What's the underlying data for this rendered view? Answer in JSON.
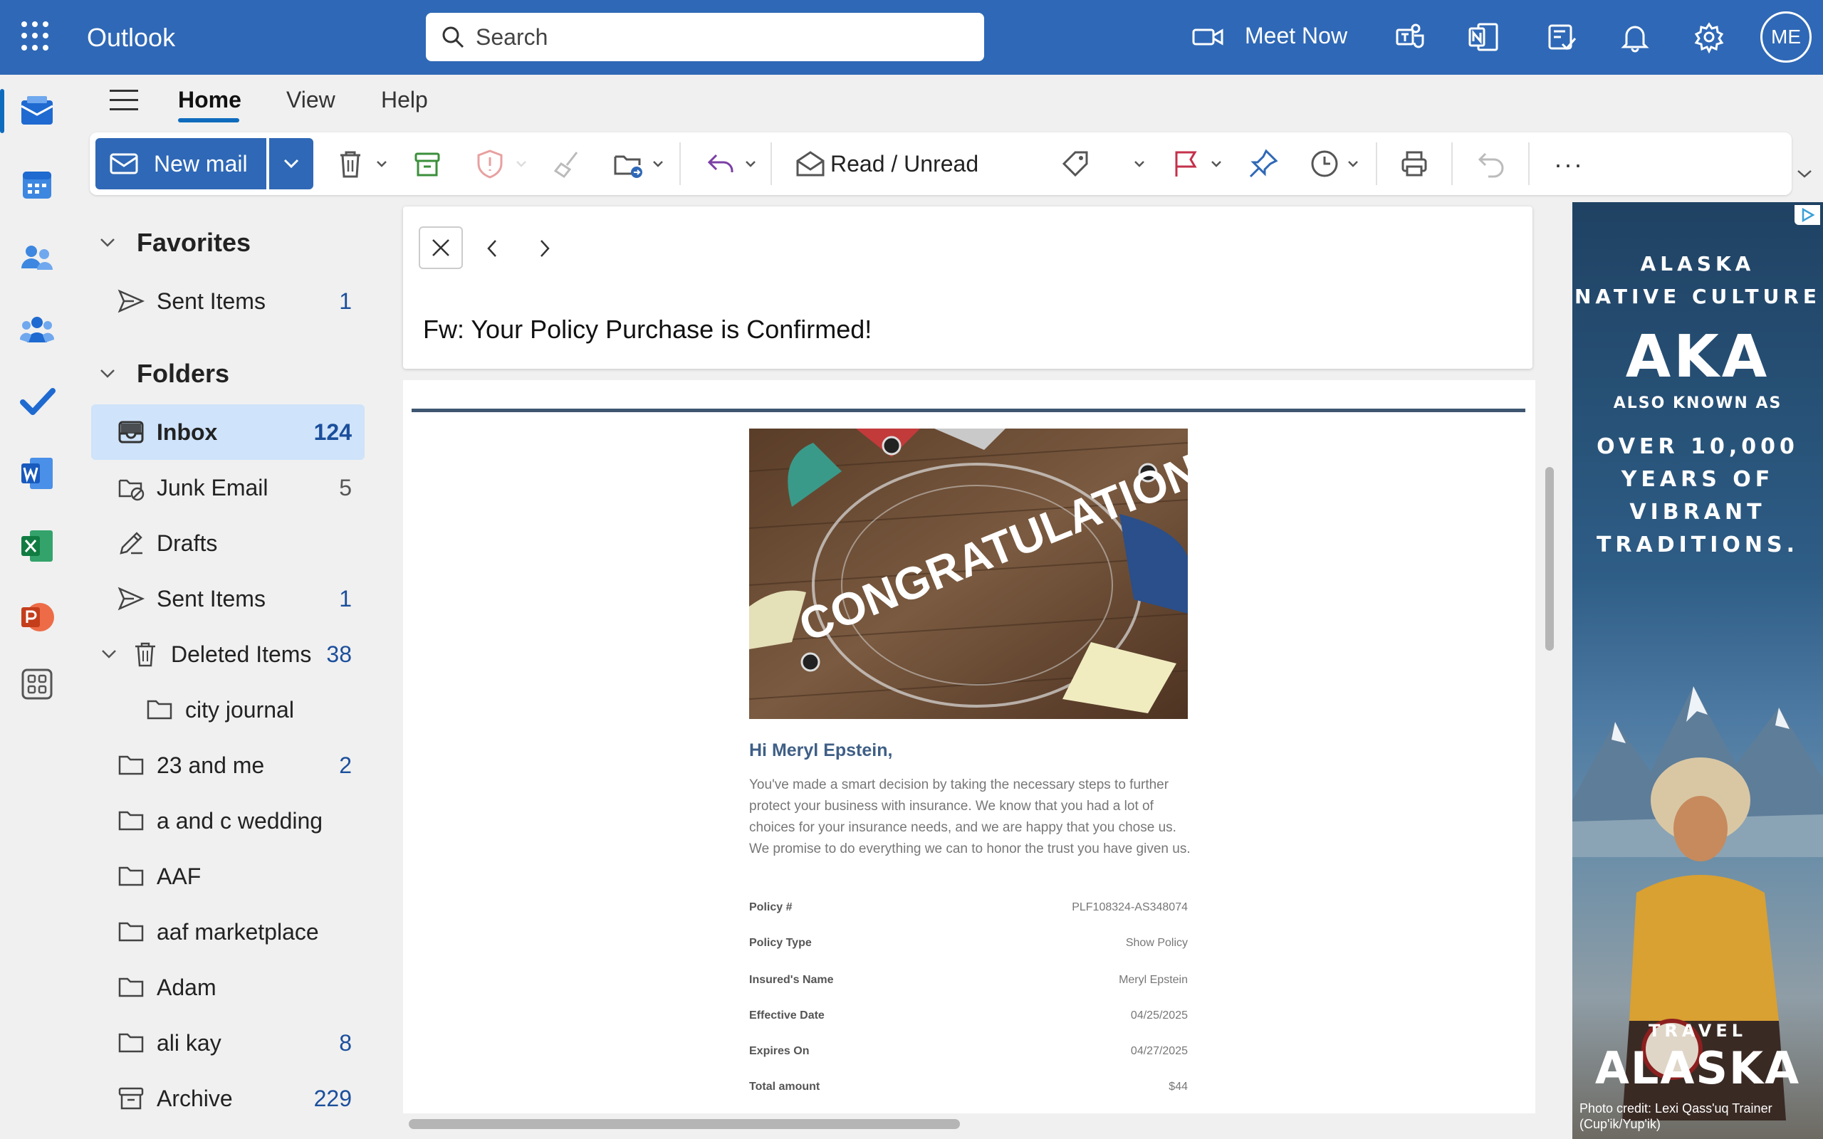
{
  "app": {
    "title": "Outlook",
    "user_initials": "ME"
  },
  "search": {
    "placeholder": "Search"
  },
  "topbar": {
    "meet_now_label": "Meet Now"
  },
  "ribbon_tabs": [
    "Home",
    "View",
    "Help"
  ],
  "toolbar": {
    "new_mail_label": "New mail",
    "read_unread_label": "Read / Unread",
    "more_label": "···"
  },
  "favorites": {
    "heading": "Favorites",
    "items": [
      {
        "label": "Sent Items",
        "count": "1"
      }
    ]
  },
  "folders": {
    "heading": "Folders",
    "items": [
      {
        "label": "Inbox",
        "count": "124"
      },
      {
        "label": "Junk Email",
        "count": "5"
      },
      {
        "label": "Drafts",
        "count": ""
      },
      {
        "label": "Sent Items",
        "count": "1"
      },
      {
        "label": "Deleted Items",
        "count": "38"
      },
      {
        "label": "city journal",
        "count": ""
      },
      {
        "label": "23 and me",
        "count": "2"
      },
      {
        "label": "a and c wedding",
        "count": ""
      },
      {
        "label": "AAF",
        "count": ""
      },
      {
        "label": "aaf marketplace",
        "count": ""
      },
      {
        "label": "Adam",
        "count": ""
      },
      {
        "label": "ali kay",
        "count": "8"
      },
      {
        "label": "Archive",
        "count": "229"
      }
    ]
  },
  "message": {
    "subject": "Fw: Your Policy Purchase is Confirmed!",
    "hero_text": "CONGRATULATIONS",
    "greeting": "Hi Meryl Epstein,",
    "body": "You've made a smart decision by taking the necessary steps to further protect your business with insurance. We know that you had a lot of choices for your insurance needs, and we are happy that you chose us. We promise to do everything we can to honor the trust you have given us.",
    "policy_rows": [
      {
        "label": "Policy #",
        "value": "PLF108324-AS348074"
      },
      {
        "label": "Policy Type",
        "value": "Show Policy"
      },
      {
        "label": "Insured's Name",
        "value": "Meryl Epstein"
      },
      {
        "label": "Effective Date",
        "value": "04/25/2025"
      },
      {
        "label": "Expires On",
        "value": "04/27/2025"
      },
      {
        "label": "Total amount",
        "value": "$44"
      }
    ]
  },
  "ad": {
    "line1": "ALASKA",
    "line2": "NATIVE CULTURE",
    "big": "AKA",
    "sub": "ALSO KNOWN AS",
    "line3": "OVER 10,000",
    "line4": "YEARS OF",
    "line5": "VIBRANT",
    "line6": "TRADITIONS.",
    "travel": "TRAVEL",
    "brand": "ALASKA",
    "credit": "Photo credit: Lexi Qass'uq Trainer (Cup'ik/Yup'ik)"
  },
  "colors": {
    "brand_blue": "#2f68b6",
    "selected_folder": "#cfe3fa",
    "count_blue": "#1b4f9c"
  }
}
